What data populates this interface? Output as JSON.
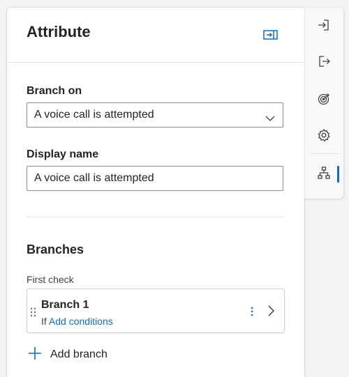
{
  "panel": {
    "title": "Attribute",
    "collapse_icon": "collapse-panel-icon"
  },
  "branch_on": {
    "label": "Branch on",
    "selected_value": "A voice call is attempted"
  },
  "display_name": {
    "label": "Display name",
    "value": "A voice call is attempted"
  },
  "branches": {
    "title": "Branches",
    "first_check_label": "First check",
    "items": [
      {
        "name": "Branch 1",
        "if_label": "If",
        "conditions_link": "Add conditions"
      }
    ],
    "add_label": "Add branch"
  },
  "side_rail": {
    "icons": [
      "sign-in-icon",
      "sign-out-icon",
      "goal-target-icon",
      "settings-gear-icon",
      "hierarchy-icon"
    ],
    "active_index": 4
  },
  "colors": {
    "accent": "#0f6cbd",
    "border": "#8a8a8a",
    "text": "#242424"
  }
}
